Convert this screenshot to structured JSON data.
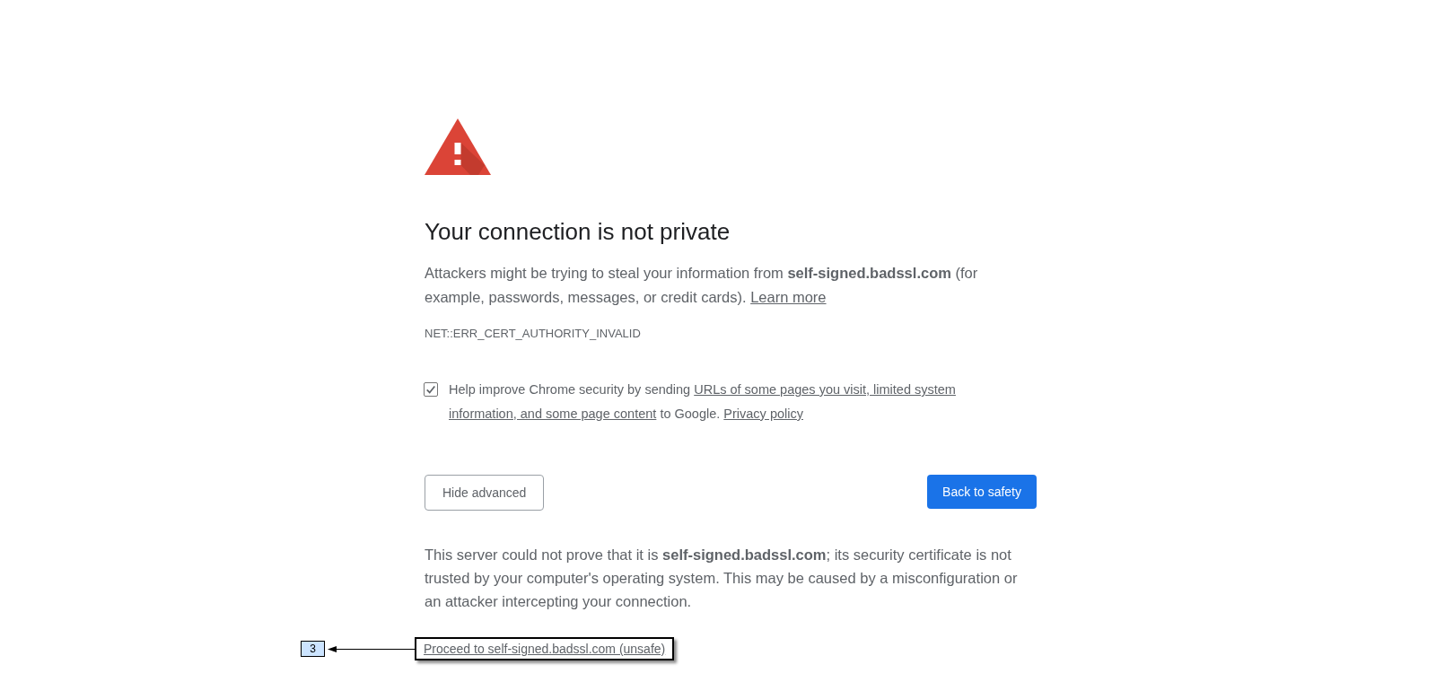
{
  "heading": "Your connection is not private",
  "intro": {
    "text": "Attackers might be trying to steal your information from **self-signed.badssl.com** (for example, passwords, messages, or credit cards).",
    "link": "Learn more"
  },
  "error_code": "NET::ERR_CERT_AUTHORITY_INVALID",
  "opt_in": {
    "checked": true,
    "parts": [
      {
        "kind": "text",
        "text": "Help improve Chrome security by sending"
      },
      {
        "kind": "link",
        "text": "URLs of some pages you visit, limited system"
      },
      {
        "kind": "link",
        "text": "information, and some page content"
      },
      {
        "kind": "text",
        "text": "to Google."
      },
      {
        "kind": "link",
        "text": "Privacy policy"
      }
    ]
  },
  "buttons": [
    {
      "label": "Hide advanced",
      "kind": "secondary"
    },
    {
      "label": "Back to safety",
      "kind": "primary"
    }
  ],
  "details": "This server could not prove that it is **self-signed.badssl.com**; its security certificate is not trusted by your computer's operating system. This may be caused by a misconfiguration or an attacker intercepting your connection.",
  "proceed_link": "Proceed to self-signed.badssl.com (unsafe)",
  "callout": {
    "label": "3"
  }
}
